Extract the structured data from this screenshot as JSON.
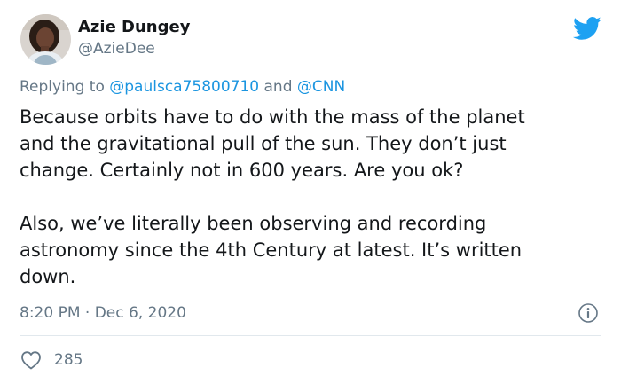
{
  "author": {
    "display_name": "Azie Dungey",
    "handle": "@AzieDee"
  },
  "reply": {
    "prefix": "Replying to ",
    "mention_1": "@paulsca75800710",
    "joiner": " and ",
    "mention_2": "@CNN"
  },
  "tweet": {
    "lines": [
      "Because orbits have to do with the mass of the planet",
      "and the gravitational pull of the sun. They don’t just",
      "change. Certainly not in 600 years. Are you ok?",
      "Also, we’ve literally been observing and recording",
      "astronomy since the 4th Century at latest. It’s written",
      "down."
    ]
  },
  "meta": {
    "timestamp": "8:20 PM · Dec 6, 2020"
  },
  "engagement": {
    "likes": "285"
  },
  "icons": {
    "brand": "twitter-bird-icon",
    "info": "info-icon",
    "like": "heart-icon"
  },
  "colors": {
    "brand_blue": "#1da1f2",
    "link_blue": "#1b95e0",
    "muted_gray": "#657786",
    "divider": "#e1e8ed"
  }
}
